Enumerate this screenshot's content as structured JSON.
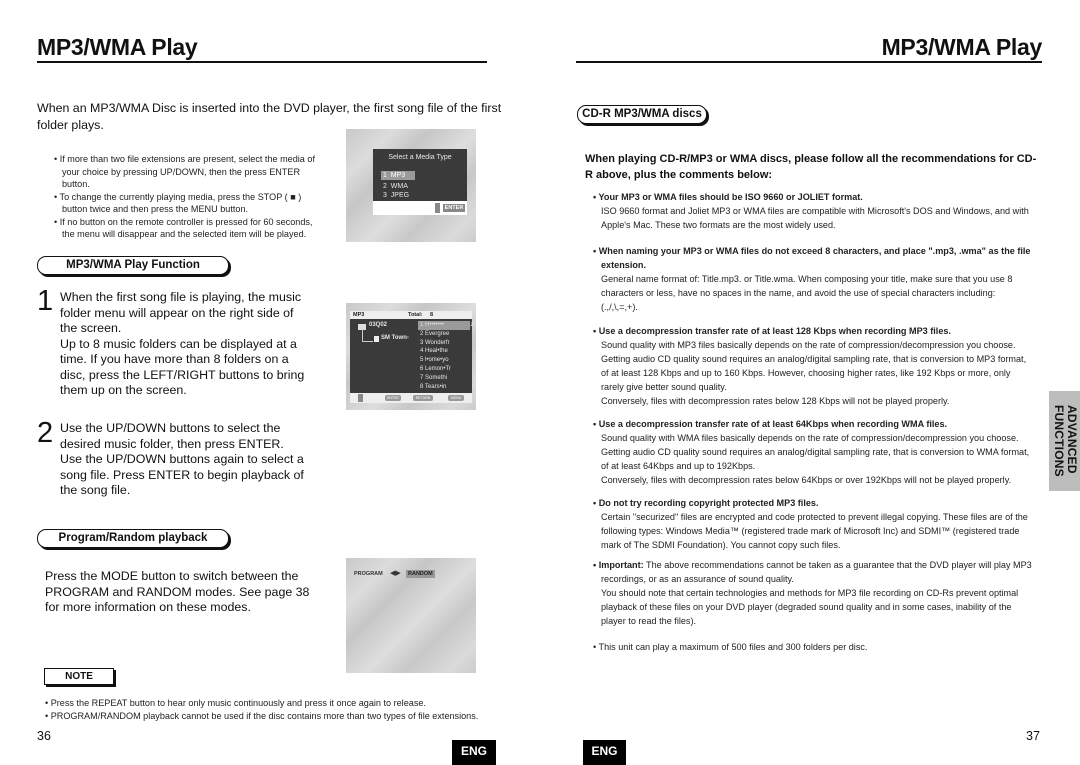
{
  "left_page": {
    "title": "MP3/WMA Play",
    "intro": "When an MP3/WMA Disc is inserted into the DVD player, the first song file of the first folder plays.",
    "bullets": [
      "• If more than two file extensions are present, select the media of your choice by pressing UP/DOWN, then the press ENTER button.",
      "• To change the currently playing media, press the STOP ( ■ ) button twice and then press the MENU button.",
      "• If no button on the remote controller is pressed for 60 seconds, the menu will disappear and the selected item will be played."
    ],
    "media_screen": {
      "heading": "Select a Media Type",
      "options": [
        {
          "num": "1",
          "label": "MP3",
          "selected": true
        },
        {
          "num": "2",
          "label": "WMA",
          "selected": false
        },
        {
          "num": "3",
          "label": "JPEG",
          "selected": false
        }
      ],
      "enter_label": "ENTER",
      "updown_icon": "up-down-arrows-icon"
    },
    "section1_title": "MP3/WMA Play Function",
    "step1": {
      "num": "1",
      "text": "When the first song file is playing, the music folder menu will appear on the right side of the screen.",
      "text2": "Up to 8 music folders can be displayed at a time. If you have more than 8 folders on a disc, press the LEFT/RIGHT buttons to bring them up on the screen."
    },
    "folder_screen": {
      "label": "MP3",
      "total_label": "Total:",
      "total_value": "8",
      "folder": "03Q02",
      "subfolder": "SM Town-",
      "files": [
        "1 H•••••••",
        "2 Evergree",
        "3 Wonderfr",
        "4 Heal•the",
        "5 l•ome•yo",
        "6 Lemon•Tr",
        "7 Somethi",
        "8 Tears•in"
      ],
      "buttons": [
        "ENTER",
        "RETURN",
        "MENU"
      ]
    },
    "step2": {
      "num": "2",
      "text": "Use the UP/DOWN buttons to select the desired music folder, then press ENTER. Use the UP/DOWN buttons again to select a song file. Press ENTER to begin playback of the song file."
    },
    "section2_title": "Program/Random playback",
    "program_text": "Press the MODE button to switch between the PROGRAM and RANDOM modes. See page 38 for more information on these modes.",
    "program_screen": {
      "program_label": "PROGRAM",
      "random_label": "RANDOM"
    },
    "note_label": "NOTE",
    "notes": [
      "• Press the REPEAT button to hear only music continuously and press it once again to release.",
      "• PROGRAM/RANDOM playback cannot be used if the disc contains more than two types of file extensions."
    ],
    "page_number": "36",
    "lang_badge": "ENG"
  },
  "right_page": {
    "title": "MP3/WMA Play",
    "section_title": "CD-R MP3/WMA discs",
    "intro": "When playing CD-R/MP3 or WMA discs, please follow all the recommendations for CD-R above, plus the comments below:",
    "items": [
      {
        "heading": "• Your MP3 or WMA files should be ISO 9660 or JOLIET format.",
        "body": [
          "ISO 9660 format and Joliet MP3 or WMA files are compatible with Microsoft's DOS and Windows, and with Apple's Mac. These two formats are the most widely used."
        ]
      },
      {
        "heading": "• When naming your MP3 or WMA files do not exceed 8 characters, and place \".mp3, .wma\" as the file extension.",
        "body": [
          "General name format of: Title.mp3. or Title.wma. When composing your title, make sure that you use 8 characters or less, have no spaces in the name, and avoid the use of special characters including: (.,/,\\,=,+)."
        ]
      },
      {
        "heading": "• Use a decompression transfer rate of at least 128 Kbps when recording MP3 files.",
        "body": [
          "Sound quality with MP3 files basically depends on the rate of compression/decompression you choose. Getting audio CD quality sound requires an analog/digital sampling rate, that is conversion to MP3 format, of at least 128 Kbps and up to 160 Kbps. However, choosing higher rates, like 192 Kbps or more, only rarely give better sound quality.",
          "Conversely, files with decompression rates below 128 Kbps will not be played properly."
        ]
      },
      {
        "heading": "• Use a decompression transfer rate of at least 64Kbps when recording WMA files.",
        "body": [
          "Sound quality with WMA files basically depends on the rate of compression/decompression you choose. Getting audio CD quality sound requires an analog/digital sampling rate, that is conversion to WMA format, of at least 64Kbps and up to 192Kbps.",
          "Conversely, files with decompression rates  below 64Kbps or over 192Kbps will not be played properly."
        ]
      },
      {
        "heading": "• Do not try recording copyright protected MP3 files.",
        "body": [
          "Certain \"securized\" files are encrypted and code protected to prevent illegal copying. These files are of the following types: Windows Media™ (registered trade mark of Microsoft Inc) and SDMI™ (registered trade mark of The SDMI Foundation). You cannot copy such files."
        ]
      }
    ],
    "important_label": "• Important:",
    "important_text": " The above recommendations cannot be taken as a guarantee that the DVD player will play MP3 recordings, or as an assurance of sound quality.",
    "important_body": "You should note that certain technologies and methods for MP3 file recording on CD-Rs prevent optimal playback of these files on your DVD player (degraded sound quality and in some cases, inability of the player to read the files).",
    "max_note": "• This unit can play a maximum of 500 files and 300 folders per disc.",
    "side_tab_line1": "ADVANCED",
    "side_tab_line2": "FUNCTIONS",
    "page_number": "37",
    "lang_badge": "ENG"
  }
}
